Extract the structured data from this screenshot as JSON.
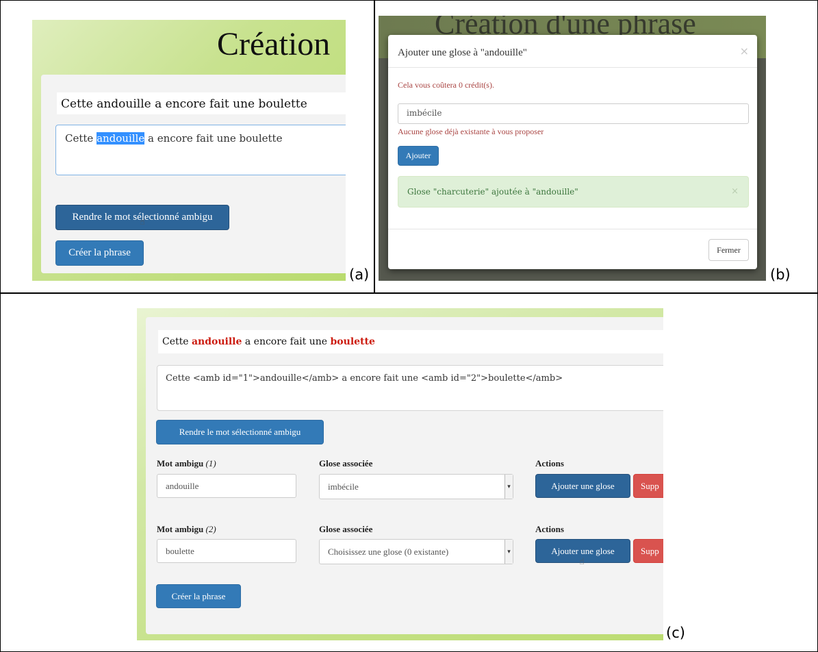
{
  "captions": {
    "a": "(a)",
    "b": "(b)",
    "c": "(c)"
  },
  "panel_a": {
    "title": "Création",
    "sentence": "Cette andouille a encore fait une boulette",
    "textarea": {
      "before": "Cette ",
      "selected": "andouille",
      "after": " a encore fait une boulette"
    },
    "ambiguous_button": "Rendre le mot sélectionné ambigu",
    "create_button": "Créer la phrase"
  },
  "panel_b": {
    "background_title": "Création d'une phrase",
    "modal_title": "Ajouter une glose à \"andouille\"",
    "close_glyph": "×",
    "cost_text": "Cela vous coûtera 0 crédit(s).",
    "input_value": "imbécile",
    "no_gloss_text": "Aucune glose déjà existante à vous proposer",
    "add_button": "Ajouter",
    "alert_text": "Glose \"charcuterie\" ajoutée à \"andouille\"",
    "close_button": "Fermer"
  },
  "panel_c": {
    "sentence": {
      "w1": "Cette ",
      "amb1": "andouille",
      "w2": " a encore fait une ",
      "amb2": "boulette"
    },
    "textarea": "Cette <amb id=\"1\">andouille</amb> a encore fait une <amb id=\"2\">boulette</amb>",
    "ambiguous_button": "Rendre le mot sélectionné ambigu",
    "rows": [
      {
        "label": "Mot ambigu",
        "num": "(1)",
        "word": "andouille",
        "gloss_label": "Glose associée",
        "gloss_value": "imbécile",
        "actions_label": "Actions",
        "add_gloss": "Ajouter une glose",
        "delete": "Supp"
      },
      {
        "label": "Mot ambigu",
        "num": "(2)",
        "word": "boulette",
        "gloss_label": "Glose associée",
        "gloss_value": "Choisissez une glose (0 existante)",
        "actions_label": "Actions",
        "add_gloss": "Ajouter une glose",
        "delete": "Supp"
      }
    ],
    "create_button": "Créer la phrase"
  }
}
